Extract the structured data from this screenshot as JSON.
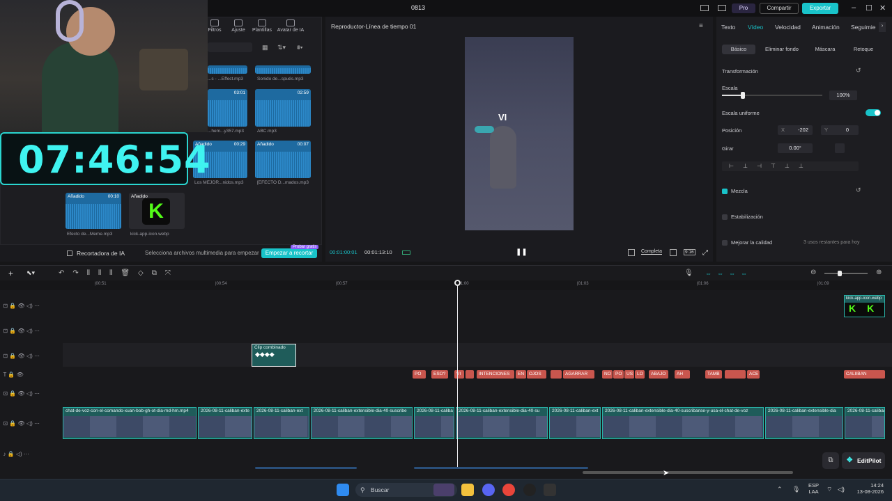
{
  "window": {
    "title": "0813",
    "pro": "Pro",
    "share": "Compartir",
    "export": "Exportar"
  },
  "media": {
    "toolbar": [
      "Filtros",
      "Ajuste",
      "Plantillas",
      "Avatar de IA"
    ],
    "items": [
      {
        "name": "...s - ...Effect.mp3",
        "badge": "",
        "dur": ""
      },
      {
        "name": "Sonido de...spués.mp3",
        "badge": "",
        "dur": ""
      },
      {
        "name": "...hem...y357.mp3",
        "badge": "",
        "dur": "03:01"
      },
      {
        "name": "ABC.mp3",
        "badge": "",
        "dur": "02:59"
      },
      {
        "name": "Los MEJOR...nidos.mp3",
        "badge": "Añadido",
        "dur": "00:29"
      },
      {
        "name": "[EFECTO D...mados.mp3",
        "badge": "Añadido",
        "dur": "00:07"
      },
      {
        "name": "Efecto de...Meme.mp3",
        "badge": "Añadido",
        "dur": "00:10"
      },
      {
        "name": "kick-app-icon.webp",
        "badge": "Añadido",
        "dur": ""
      }
    ]
  },
  "overlay": {
    "clock": "07:46:54"
  },
  "ia_bar": {
    "label": "Recortadora de IA",
    "hint": "Selecciona archivos multimedia para empezar",
    "button": "Empezar a recortar",
    "tag": "Probar gratis"
  },
  "preview": {
    "title": "Reproductor-Línea de tiempo 01",
    "current": "00:01:00:01",
    "total": "00:01:13:10",
    "mode": "Completa",
    "ratio": "9:16",
    "video_text": "VI"
  },
  "inspector": {
    "tabs": [
      "Texto",
      "Vídeo",
      "Velocidad",
      "Animación",
      "Seguimie"
    ],
    "subtabs": [
      "Básico",
      "Eliminar fondo",
      "Máscara",
      "Retoque"
    ],
    "transform": "Transformación",
    "scale_label": "Escala",
    "scale_value": "100%",
    "uniform": "Escala uniforme",
    "position": "Posición",
    "pos_x": "-202",
    "pos_y": "0",
    "x_label": "X",
    "y_label": "Y",
    "rotate": "Girar",
    "rotate_value": "0.00°",
    "blend": "Mezcla",
    "stabilize": "Estabilización",
    "quality": "Mejorar la calidad",
    "quality_note": "3 usos restantes para hoy"
  },
  "timeline": {
    "ruler": [
      "|00:51",
      "|00:54",
      "|00:57",
      "|01:00",
      "|01:03",
      "|01:06",
      "|01:09"
    ],
    "compound": "Clip combinado",
    "kick_clip": "kick-app-icon.webp",
    "captions": [
      "PO",
      "ESO?",
      "VI",
      "INTENCIONES",
      "EN",
      "OJOS",
      "AGARRAR",
      "NO",
      "PO",
      "US",
      "LO",
      "ABAJO",
      "AH",
      "TAMB",
      "ACE",
      "CALIIBAN"
    ],
    "video_clips": [
      "chat-de-voz-con-el-comando-xuan-bob-gh-ot-dia-md-hm.mp4",
      "2026-08-11-caliban-exte",
      "2026-08-11-caliban-ext",
      "2026-08-11-caliban-extensible-dia-40-suscribe",
      "2026-08-11-caliba",
      "2026-08-11-caliban-extensible-dia-40-su",
      "2026-08-11-caliban-ext",
      "2026-08-11-caliban-extensible-dia-40-suscribanse-y-usa-el-chat-de-voz",
      "2026-08-11-caliban-extensible-dia"
    ],
    "editpilot": "EditPilot"
  },
  "taskbar": {
    "search": "Buscar",
    "lang": "ESP",
    "lang2": "LAA",
    "time": "14:24",
    "date": "13-08-2026"
  }
}
